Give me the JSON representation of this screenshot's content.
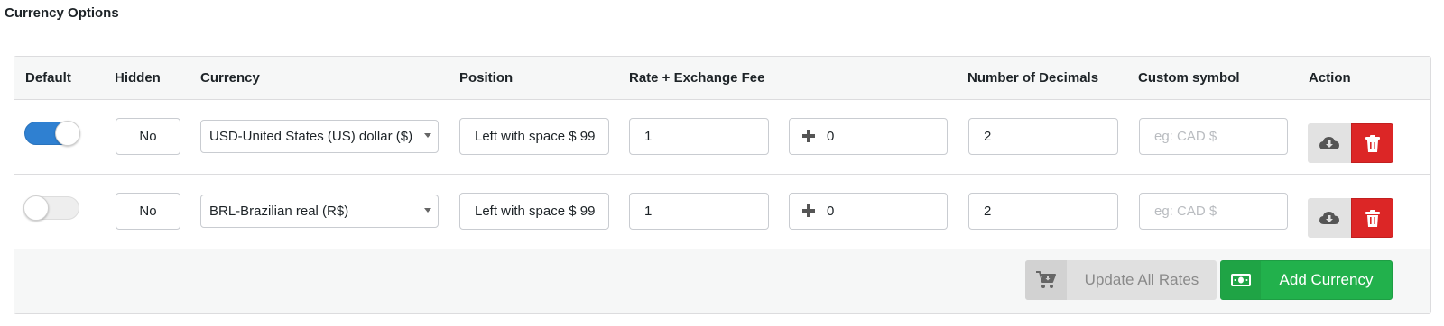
{
  "page": {
    "title": "Currency Options"
  },
  "columns": {
    "default": "Default",
    "hidden": "Hidden",
    "currency": "Currency",
    "position": "Position",
    "rate": "Rate + Exchange Fee",
    "decimals": "Number of Decimals",
    "symbol": "Custom symbol",
    "action": "Action"
  },
  "rows": [
    {
      "default_enabled": true,
      "hidden": "No",
      "currency": "USD-United States (US) dollar ($)",
      "position": "Left with space $ 99",
      "rate": "1",
      "fee": "0",
      "decimals": "2",
      "symbol_placeholder": "eg: CAD $",
      "symbol_value": ""
    },
    {
      "default_enabled": false,
      "hidden": "No",
      "currency": "BRL-Brazilian real (R$)",
      "position": "Left with space $ 99",
      "rate": "1",
      "fee": "0",
      "decimals": "2",
      "symbol_placeholder": "eg: CAD $",
      "symbol_value": ""
    }
  ],
  "footer": {
    "update_all_label": "Update All Rates",
    "add_currency_label": "Add Currency"
  },
  "icons": {
    "download": "cloud-download-icon",
    "delete": "trash-icon",
    "plus": "plus-icon",
    "update": "cart-download-icon",
    "add": "banknote-icon"
  },
  "colors": {
    "toggle_on": "#2f80d1",
    "delete": "#dc2626",
    "add": "#22b14c"
  }
}
